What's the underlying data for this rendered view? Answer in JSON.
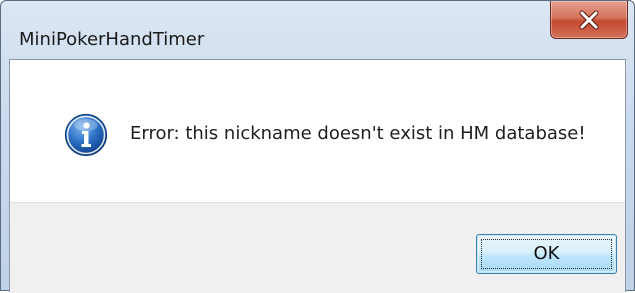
{
  "window": {
    "title": "MiniPokerHandTimer",
    "close_icon": "close-x-icon"
  },
  "dialog": {
    "icon": "information-icon",
    "message": "Error: this nickname doesn't exist in HM database!",
    "ok_label": "OK"
  },
  "colors": {
    "titlebar": "#c9d9ed",
    "close_button": "#c34a2f",
    "footer": "#f0f0f0",
    "info_icon": "#1f5fb5",
    "ok_button_border": "#3c7fb1"
  }
}
